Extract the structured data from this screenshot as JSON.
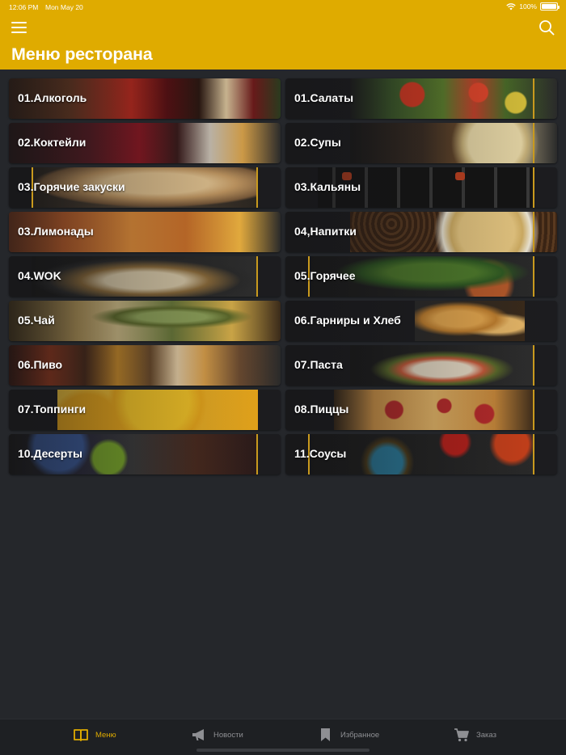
{
  "status_bar": {
    "time": "12:06 PM",
    "date": "Mon May 20",
    "battery": "100%"
  },
  "header": {
    "title": "Меню ресторана",
    "background_color": "#dfab00",
    "menu_icon": "hamburger-menu-icon",
    "search_icon": "search-icon"
  },
  "categories": [
    {
      "label": "01.Алкоголь"
    },
    {
      "label": "01.Салаты"
    },
    {
      "label": "02.Коктейли"
    },
    {
      "label": "02.Супы"
    },
    {
      "label": "03.Горячие закуски"
    },
    {
      "label": "03.Кальяны"
    },
    {
      "label": "03.Лимонады"
    },
    {
      "label": "04,Напитки"
    },
    {
      "label": "04.WOK"
    },
    {
      "label": "05.Горячее"
    },
    {
      "label": "05.Чай"
    },
    {
      "label": "06.Гарниры и Хлеб"
    },
    {
      "label": "06.Пиво"
    },
    {
      "label": "07.Паста"
    },
    {
      "label": "07.Топпинги"
    },
    {
      "label": "08.Пиццы"
    },
    {
      "label": "10.Десерты"
    },
    {
      "label": "11.Соусы"
    }
  ],
  "tabbar": {
    "tabs": [
      {
        "label": "Меню",
        "icon": "book-icon",
        "active": true
      },
      {
        "label": "Новости",
        "icon": "megaphone-icon",
        "active": false
      },
      {
        "label": "Избранное",
        "icon": "bookmark-icon",
        "active": false
      },
      {
        "label": "Заказ",
        "icon": "cart-icon",
        "active": false
      }
    ],
    "active_color": "#dfab00",
    "inactive_color": "#8e8f93"
  }
}
